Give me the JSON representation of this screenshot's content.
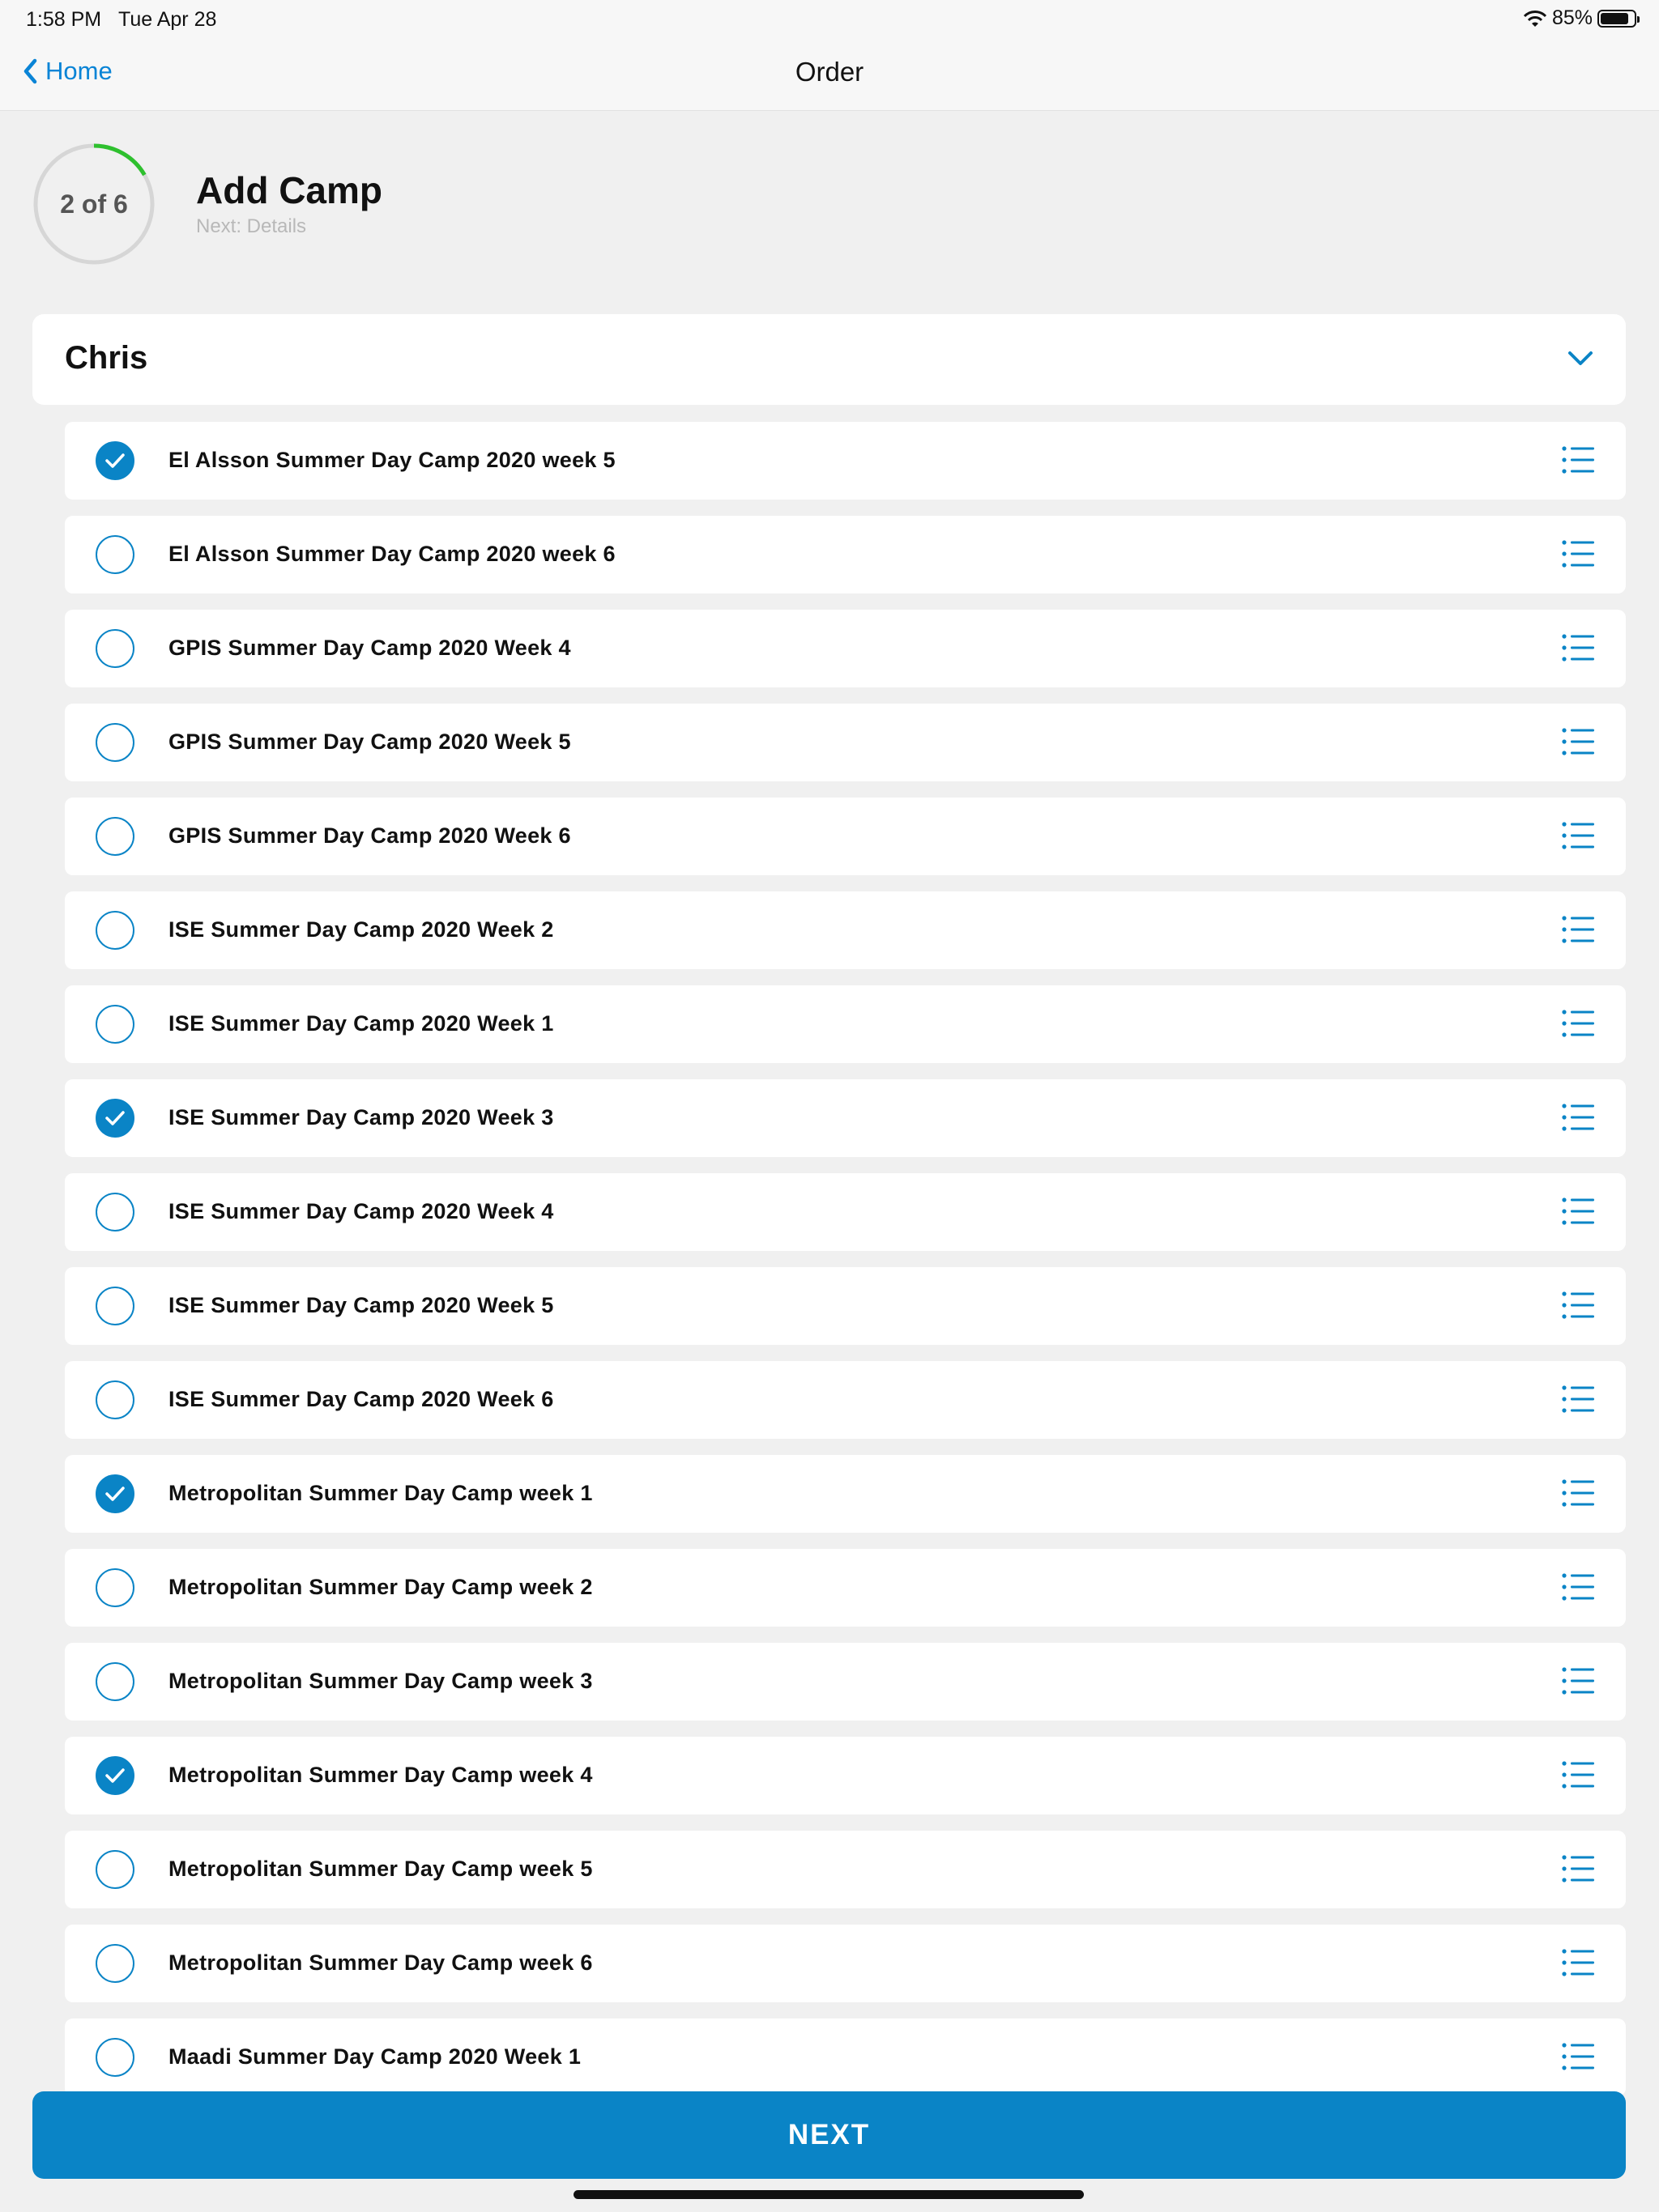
{
  "status_bar": {
    "time": "1:58 PM",
    "date": "Tue Apr 28",
    "battery": "85%",
    "battery_level": 0.85
  },
  "nav": {
    "back_label": "Home",
    "title": "Order"
  },
  "progress": {
    "label": "2 of 6",
    "current": 2,
    "total": 6,
    "ring_color": "#2ec02e",
    "title": "Add Camp",
    "next": "Next: Details"
  },
  "person": {
    "name": "Chris"
  },
  "camps": [
    {
      "label": "El Alsson Summer Day Camp 2020 week 5",
      "checked": true
    },
    {
      "label": "El Alsson Summer Day Camp 2020 week 6",
      "checked": false
    },
    {
      "label": "GPIS Summer Day Camp 2020 Week 4",
      "checked": false
    },
    {
      "label": "GPIS Summer Day Camp 2020 Week 5",
      "checked": false
    },
    {
      "label": "GPIS Summer Day Camp 2020 Week 6",
      "checked": false
    },
    {
      "label": "ISE Summer Day Camp 2020 Week 2",
      "checked": false
    },
    {
      "label": "ISE Summer Day Camp 2020 Week 1",
      "checked": false
    },
    {
      "label": "ISE Summer Day Camp 2020 Week 3",
      "checked": true
    },
    {
      "label": "ISE Summer Day Camp 2020 Week 4",
      "checked": false
    },
    {
      "label": "ISE Summer Day Camp 2020 Week 5",
      "checked": false
    },
    {
      "label": "ISE Summer Day Camp 2020 Week 6",
      "checked": false
    },
    {
      "label": "Metropolitan Summer Day Camp week 1",
      "checked": true
    },
    {
      "label": "Metropolitan Summer Day Camp week 2",
      "checked": false
    },
    {
      "label": "Metropolitan Summer Day Camp week 3",
      "checked": false
    },
    {
      "label": "Metropolitan Summer Day Camp week 4",
      "checked": true
    },
    {
      "label": "Metropolitan Summer Day Camp week 5",
      "checked": false
    },
    {
      "label": "Metropolitan Summer Day Camp week 6",
      "checked": false
    },
    {
      "label": "Maadi Summer Day Camp 2020 Week 1",
      "checked": false
    }
  ],
  "actions": {
    "next_label": "NEXT"
  },
  "colors": {
    "accent": "#0a84c6",
    "link": "#0a84d6",
    "progress": "#2ec02e"
  }
}
